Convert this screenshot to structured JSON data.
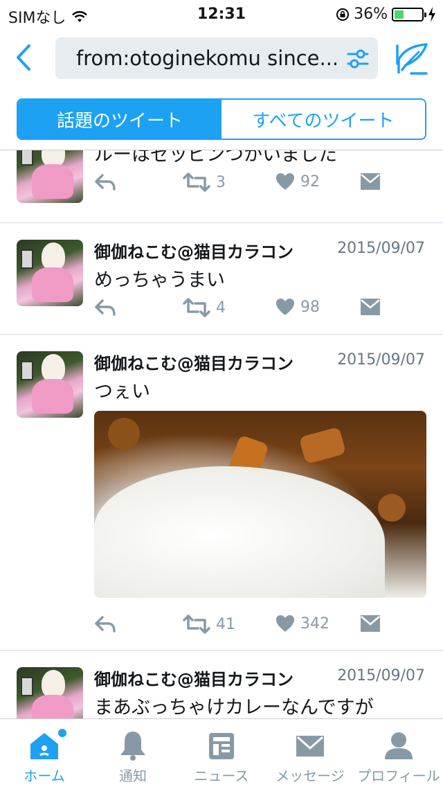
{
  "status_bar": {
    "carrier": "SIMなし",
    "time": "12:31",
    "battery_percent": "36%",
    "battery_level": 0.36
  },
  "nav": {
    "search_query": "from:otoginekomu since..."
  },
  "segments": {
    "top_tweets": "話題のツイート",
    "all_tweets": "すべてのツイート"
  },
  "tweets": [
    {
      "text": "ルーはゼッピンつかいました",
      "retweets": "3",
      "likes": "92"
    },
    {
      "name": "御伽ねこむ@猫目カラコン",
      "date": "2015/09/07",
      "text": "めっちゃうまい",
      "retweets": "4",
      "likes": "98"
    },
    {
      "name": "御伽ねこむ@猫目カラコン",
      "date": "2015/09/07",
      "text": "つぇい",
      "retweets": "41",
      "likes": "342"
    },
    {
      "name": "御伽ねこむ@猫目カラコン",
      "date": "2015/09/07",
      "text": "まあぶっちゃけカレーなんですが"
    }
  ],
  "tabbar": {
    "home": "ホーム",
    "notifications": "通知",
    "news": "ニュース",
    "messages": "メッセージ",
    "profile": "プロフィール"
  },
  "colors": {
    "accent": "#1da1f2",
    "muted": "#8899a6"
  }
}
